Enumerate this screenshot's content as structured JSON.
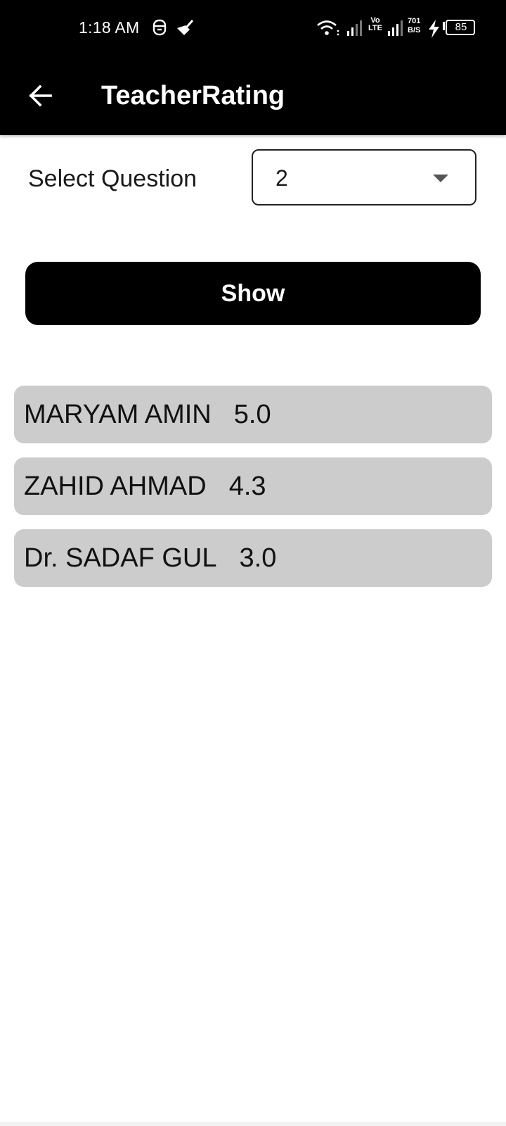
{
  "status_bar": {
    "time": "1:18 AM",
    "network_speed_value": "701",
    "network_speed_unit": "B/S",
    "volte_top": "Vo",
    "volte_bottom": "LTE",
    "battery": "85"
  },
  "app_bar": {
    "title": "TeacherRating"
  },
  "form": {
    "select_label": "Select Question",
    "selected_question": "2",
    "show_label": "Show"
  },
  "ratings": [
    {
      "name": "MARYAM AMIN",
      "score": "5.0"
    },
    {
      "name": "ZAHID AHMAD",
      "score": "4.3"
    },
    {
      "name": "Dr. SADAF GUL",
      "score": "3.0"
    }
  ],
  "colors": {
    "bar_background": "#000000",
    "item_background": "#cccccc",
    "page_background": "#ffffff"
  },
  "icons": {
    "back": "arrow-left-icon",
    "dropdown": "caret-down-icon"
  }
}
